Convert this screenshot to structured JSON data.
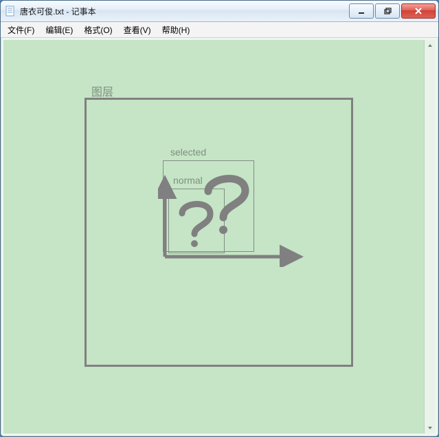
{
  "window": {
    "title": "唐衣可俊.txt - 记事本"
  },
  "menubar": {
    "items": [
      {
        "label": "文件(F)"
      },
      {
        "label": "编辑(E)"
      },
      {
        "label": "格式(O)"
      },
      {
        "label": "查看(V)"
      },
      {
        "label": "帮助(H)"
      }
    ]
  },
  "content": {
    "layer_label": "图层",
    "selected_label": "selected",
    "normal_label": "normal"
  }
}
